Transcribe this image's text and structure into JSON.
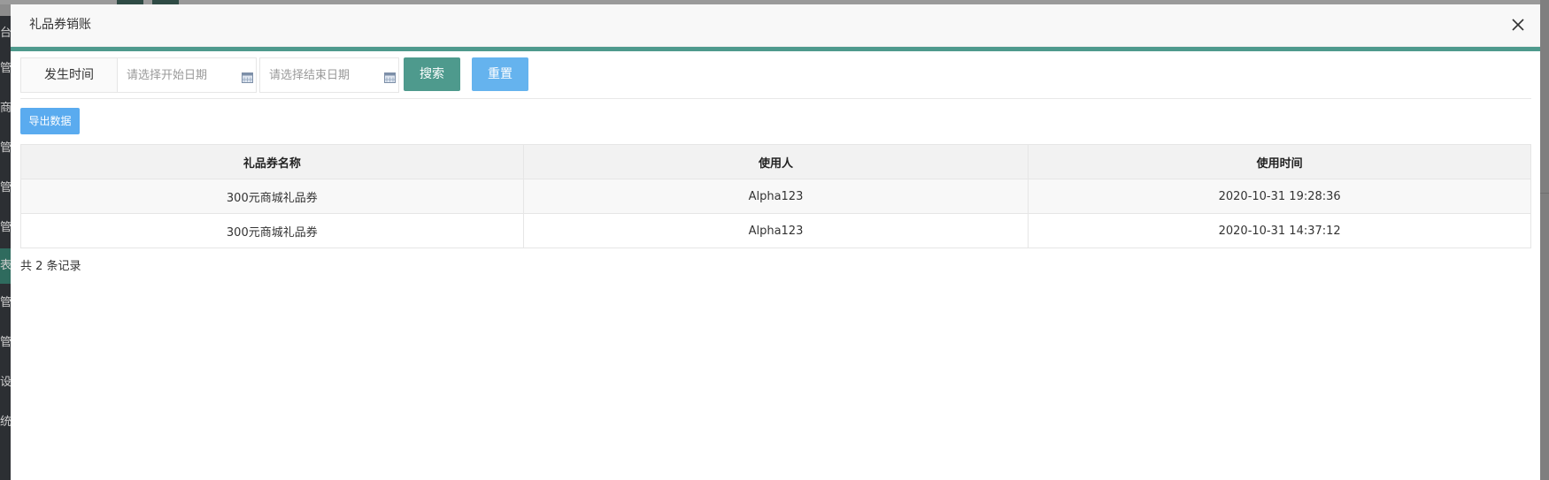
{
  "background": {
    "sidebar_items": [
      {
        "label": "台",
        "active": false
      },
      {
        "label": "管",
        "active": false
      },
      {
        "label": "商",
        "active": false
      },
      {
        "label": "管",
        "active": false
      },
      {
        "label": "管",
        "active": false
      },
      {
        "label": "管",
        "active": false
      },
      {
        "label": "表",
        "active": true
      },
      {
        "label": "管",
        "active": false
      },
      {
        "label": "管",
        "active": false
      },
      {
        "label": "设",
        "active": false
      },
      {
        "label": "统",
        "active": false
      }
    ]
  },
  "modal": {
    "title": "礼品券销账",
    "close_icon": "close-icon",
    "accent_color": "#4e9a8d"
  },
  "filter": {
    "label": "发生时间",
    "start_date": {
      "value": "",
      "placeholder": "请选择开始日期",
      "icon": "calendar-icon"
    },
    "end_date": {
      "value": "",
      "placeholder": "请选择结束日期",
      "icon": "calendar-icon"
    },
    "search_label": "搜索",
    "reset_label": "重置"
  },
  "toolbar": {
    "export_label": "导出数据"
  },
  "table": {
    "headers": [
      "礼品券名称",
      "使用人",
      "使用时间"
    ],
    "rows": [
      [
        "300元商城礼品券",
        "Alpha123",
        "2020-10-31 19:28:36"
      ],
      [
        "300元商城礼品券",
        "Alpha123",
        "2020-10-31 14:37:12"
      ]
    ]
  },
  "pagination": {
    "record_count": "共 2 条记录"
  },
  "colors": {
    "search_button": "#4e9a8d",
    "reset_button": "#65b3ee",
    "export_button": "#5aabef"
  }
}
